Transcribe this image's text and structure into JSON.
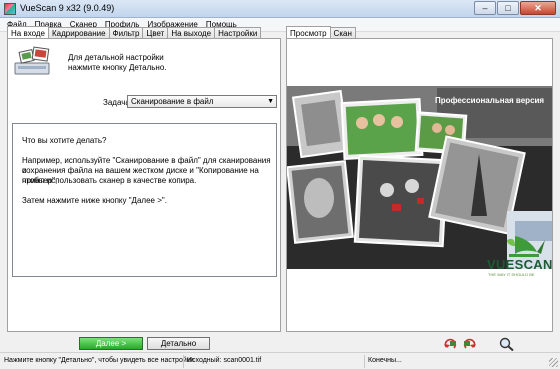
{
  "window": {
    "title": "VueScan 9 x32 (9.0.49)",
    "minimize": "–",
    "maximize": "□",
    "close": "✕"
  },
  "menu": [
    "Файл",
    "Правка",
    "Сканер",
    "Профиль",
    "Изображение",
    "Помощь"
  ],
  "left_tabs": [
    "На входе",
    "Кадрирование",
    "Фильтр",
    "Цвет",
    "На выходе",
    "Настройки"
  ],
  "right_tabs": [
    "Просмотр",
    "Скан"
  ],
  "hint": {
    "line1": "Для детальной настройки",
    "line2": "нажмите кнопку Детально."
  },
  "task": {
    "label": "Задача:",
    "value": "Сканирование в файл"
  },
  "info": {
    "question": "Что вы хотите делать?",
    "p1_l1": "Например, используйте \"Сканирование в файл\" для сканирования и",
    "p1_l2": "сохранения файла на вашем жестком диске и \"Копирование на принтер\",",
    "p1_l3": "чтобы использовать сканер в качестве копира.",
    "p2": "Затем нажмите ниже кнопку \"Далее >\"."
  },
  "preview": {
    "version_text": "Профессиональная версия"
  },
  "logo": {
    "text": "VUESCAN",
    "tagline": "THE WAY IT SHOULD BE"
  },
  "buttons": {
    "next": "Далее >",
    "detail": "Детально"
  },
  "icons": {
    "scanner": "scanner-photos-icon",
    "rotate_left": "rotate-left-icon",
    "rotate_right": "rotate-right-icon",
    "zoom": "zoom-icon"
  },
  "status": {
    "hint": "Нажмите кнопку \"Детально\", чтобы увидеть все настройки",
    "source": "Исходный: scan0001.tif",
    "end": "Конечны..."
  },
  "colors": {
    "next_button": "#3bb53b",
    "logo_green": "#1b5c35",
    "title_bar": "#c8d9ee"
  }
}
